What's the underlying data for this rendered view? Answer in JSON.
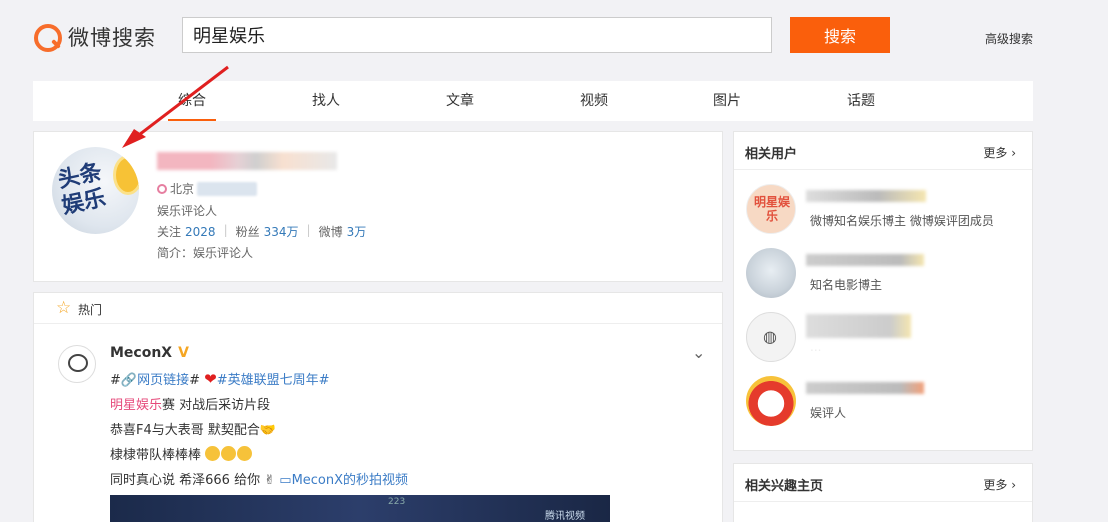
{
  "header": {
    "logo_text": "微博搜索",
    "search_value": "明星娱乐",
    "search_button": "搜索",
    "advanced_search": "高级搜索"
  },
  "tabs": [
    "综合",
    "找人",
    "文章",
    "视频",
    "图片",
    "话题"
  ],
  "user_card": {
    "avatar_text_line1": "头条",
    "avatar_text_line2": "娱乐",
    "location": "北京",
    "description": "娱乐评论人",
    "follow_label": "关注",
    "follow_count": "2028",
    "fans_label": "粉丝",
    "fans_count": "334万",
    "weibo_label": "微博",
    "weibo_count": "3万",
    "intro": "简介：娱乐评论人"
  },
  "hot_card": {
    "label": "热门",
    "post": {
      "username": "MeconX",
      "line1_prefix": "#",
      "line1_link": "🔗网页链接",
      "line1_mid": "#",
      "line1_topic": "#英雄联盟七周年#",
      "line2_highlight": "明星娱乐",
      "line2_rest": "赛 对战后采访片段",
      "line3": "恭喜F4与大表哥 默契配合",
      "line4": "棣棣带队棒棒棒",
      "line5_text": "同时真心说 希泽666 给你",
      "line5_link": "MeconX的秒拍视频",
      "video_text_1": "223",
      "video_text_2": "腾讯视频"
    }
  },
  "related_users": {
    "title": "相关用户",
    "more": "更多",
    "users": [
      {
        "avatar_text": "明星娱乐",
        "description": "微博知名娱乐博主 微博娱评团成员"
      },
      {
        "description": "知名电影博主"
      },
      {
        "description": "..."
      },
      {
        "description": "娱评人"
      }
    ]
  },
  "related_interest": {
    "title": "相关兴趣主页",
    "more": "更多"
  }
}
